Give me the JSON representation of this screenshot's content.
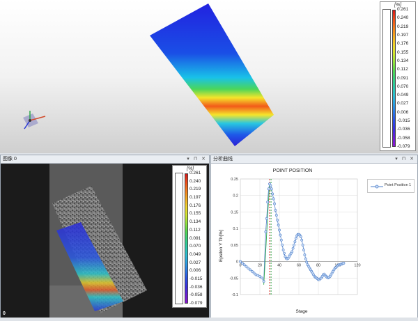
{
  "panels": {
    "image_title": "图像 0",
    "analysis_title": "分析曲线",
    "panel_controls": "▾ ⊓ ✕",
    "camera_index": "0"
  },
  "colorscale": {
    "unit": "[%]",
    "labels": [
      "0.261",
      "0.240",
      "0.219",
      "0.197",
      "0.176",
      "0.155",
      "0.134",
      "0.112",
      "0.091",
      "0.070",
      "0.049",
      "0.027",
      "0.006",
      "-0.015",
      "-0.036",
      "-0.058",
      "-0.079"
    ]
  },
  "chart_data": {
    "type": "scatter",
    "title": "POINT POSITION",
    "xlabel": "Stage",
    "ylabel": "Epsilon Y Th[%]",
    "xlim": [
      0,
      120
    ],
    "ylim": [
      -0.1,
      0.25
    ],
    "xticks": [
      0,
      20,
      40,
      60,
      80,
      100,
      120
    ],
    "yticks": [
      -0.1,
      -0.05,
      0,
      0.05,
      0.1,
      0.15,
      0.2,
      0.25
    ],
    "grid": true,
    "legend_position": "top-right",
    "vertical_markers": [
      {
        "x": 30,
        "color": "#d6322a"
      },
      {
        "x": 31.5,
        "color": "#2ea84a"
      }
    ],
    "series": [
      {
        "name": "Point Position 1",
        "color": "#4a7cc9",
        "green_segment": {
          "x": [
            24,
            26,
            28,
            30
          ],
          "y": [
            -0.07,
            0.03,
            0.14,
            0.235
          ]
        },
        "x": [
          0,
          2,
          4,
          6,
          8,
          10,
          12,
          14,
          16,
          18,
          20,
          22,
          24,
          26,
          27,
          28,
          29,
          30,
          31,
          32,
          33,
          34,
          35,
          36,
          37,
          38,
          39,
          40,
          41,
          42,
          43,
          44,
          45,
          46,
          47,
          48,
          49,
          50,
          51,
          52,
          53,
          54,
          55,
          56,
          57,
          58,
          59,
          60,
          61,
          62,
          63,
          64,
          65,
          66,
          67,
          68,
          69,
          70,
          71,
          72,
          73,
          74,
          75,
          76,
          77,
          78,
          79,
          80,
          81,
          82,
          83,
          84,
          85,
          86,
          87,
          88,
          89,
          90,
          91,
          92,
          93,
          94,
          95,
          96,
          97,
          98,
          99,
          100,
          101,
          102,
          103,
          104,
          105,
          106
        ],
        "y": [
          0,
          -0.005,
          -0.01,
          -0.015,
          -0.02,
          -0.025,
          -0.03,
          -0.035,
          -0.04,
          -0.042,
          -0.045,
          -0.05,
          -0.06,
          0.09,
          0.13,
          0.18,
          0.22,
          0.235,
          0.23,
          0.22,
          0.205,
          0.19,
          0.175,
          0.155,
          0.14,
          0.125,
          0.11,
          0.095,
          0.08,
          0.065,
          0.05,
          0.035,
          0.025,
          0.015,
          0.01,
          0.008,
          0.01,
          0.015,
          0.02,
          0.025,
          0.03,
          0.04,
          0.05,
          0.06,
          0.07,
          0.078,
          0.082,
          0.082,
          0.08,
          0.075,
          0.065,
          0.05,
          0.035,
          0.02,
          0.008,
          -0.002,
          -0.01,
          -0.015,
          -0.02,
          -0.025,
          -0.03,
          -0.035,
          -0.04,
          -0.045,
          -0.048,
          -0.05,
          -0.052,
          -0.055,
          -0.055,
          -0.052,
          -0.05,
          -0.045,
          -0.04,
          -0.038,
          -0.042,
          -0.045,
          -0.048,
          -0.05,
          -0.048,
          -0.045,
          -0.04,
          -0.035,
          -0.03,
          -0.025,
          -0.02,
          -0.018,
          -0.015,
          -0.012,
          -0.01,
          -0.01,
          -0.008,
          -0.008,
          -0.006,
          -0.005
        ]
      }
    ]
  }
}
